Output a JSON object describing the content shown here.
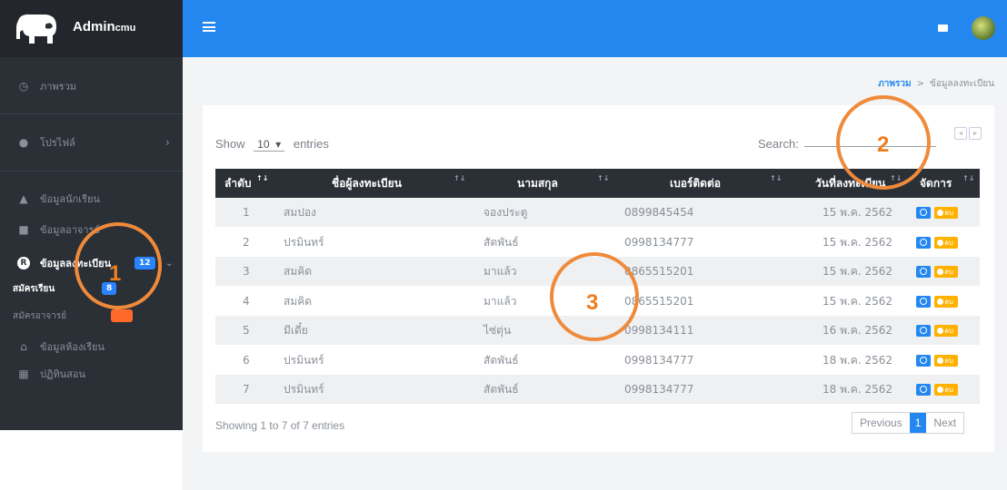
{
  "brand": {
    "name": "Admin",
    "suffix": "cmu"
  },
  "sidebar": {
    "items": [
      {
        "label": "ภาพรวม",
        "icon": "dashboard-icon"
      },
      {
        "label": "โปรไฟล์",
        "icon": "user-circle-icon"
      },
      {
        "label": "ข้อมูลนักเรียน",
        "icon": "graduation-cap-icon"
      },
      {
        "label": "ข้อมูลอาจารย์",
        "icon": "address-book-icon"
      },
      {
        "label": "ข้อมูลลงทะเบียน",
        "icon": "registered-icon",
        "badge": "12"
      },
      {
        "label": "ข้อมูลห้องเรียน",
        "icon": "home-icon"
      },
      {
        "label": "ปฏิทินสอน",
        "icon": "calendar-icon"
      }
    ],
    "subitems": [
      {
        "label": "สมัครเรียน",
        "badge": "8"
      },
      {
        "label": "สมัครอาจารย์",
        "badge": ""
      }
    ]
  },
  "breadcrumb": {
    "home": "ภาพรวม",
    "current": "ข้อมูลลงทะเบียน"
  },
  "table_controls": {
    "show_label": "Show",
    "show_value": "10",
    "entries_label": "entries",
    "search_label": "Search:"
  },
  "table": {
    "headers": [
      "ลำดับ",
      "ชื่อผู้ลงทะเบียน",
      "นามสกุล",
      "เบอร์ติดต่อ",
      "วันที่ลงทะเบียน",
      "จัดการ"
    ],
    "rows": [
      {
        "no": "1",
        "name": "สมปอง",
        "surname": "จองประตู",
        "phone": "0899845454",
        "date": "15 พ.ค. 2562"
      },
      {
        "no": "2",
        "name": "ปรมินทร์",
        "surname": "สัตพันธ์",
        "phone": "0998134777",
        "date": "15 พ.ค. 2562"
      },
      {
        "no": "3",
        "name": "สมคิด",
        "surname": "มาแล้ว",
        "phone": "0865515201",
        "date": "15 พ.ค. 2562"
      },
      {
        "no": "4",
        "name": "สมคิด",
        "surname": "มาแล้ว",
        "phone": "0865515201",
        "date": "15 พ.ค. 2562"
      },
      {
        "no": "5",
        "name": "มีเดี๋ย",
        "surname": "ไซ่ตุ่น",
        "phone": "0998134111",
        "date": "16 พ.ค. 2562"
      },
      {
        "no": "6",
        "name": "ปรมินทร์",
        "surname": "สัตพันธ์",
        "phone": "0998134777",
        "date": "18 พ.ค. 2562"
      },
      {
        "no": "7",
        "name": "ปรมินทร์",
        "surname": "สัตพันธ์",
        "phone": "0998134777",
        "date": "18 พ.ค. 2562"
      }
    ],
    "delete_label": "ลบ"
  },
  "footer": {
    "info": "Showing 1 to 7 of 7 entries",
    "previous": "Previous",
    "page": "1",
    "next": "Next"
  },
  "annotations": [
    "1",
    "2",
    "3"
  ],
  "colors": {
    "topbar": "#2487f0",
    "sidebar": "#2b3037",
    "accent_orange": "#ef8a3a",
    "badge_blue": "#2a83ff"
  }
}
